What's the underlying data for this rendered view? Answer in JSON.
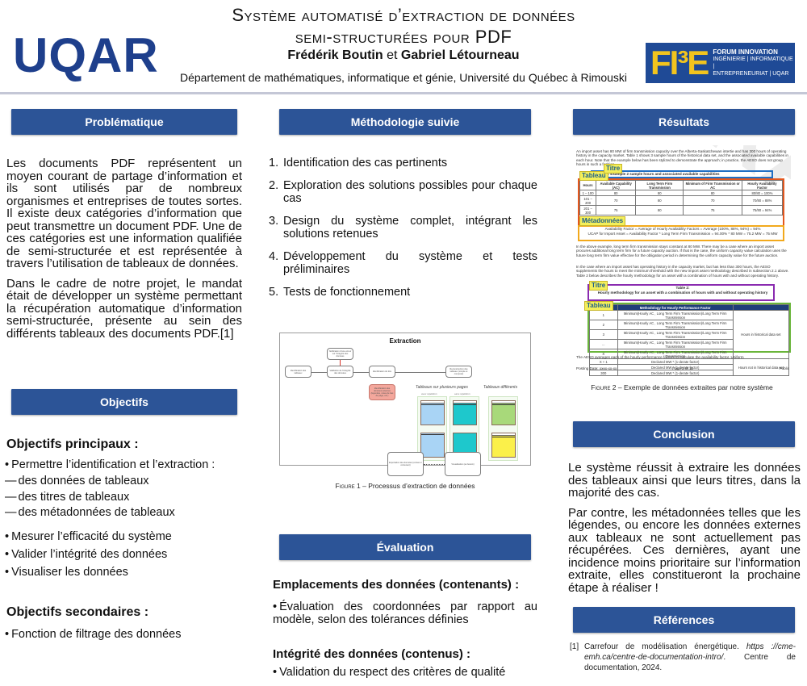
{
  "header": {
    "logo_left": "UQAR",
    "title_line1": "Système automatisé d’extraction de données",
    "title_line2": "semi-structurées pour PDF",
    "author1": "Frédérik Boutin",
    "author_joiner": " et ",
    "author2": "Gabriel Létourneau",
    "department": "Département de mathématiques, informatique et génie, Université du Québec à Rimouski",
    "logo_right": {
      "letters": "FI³E",
      "line1": "FORUM INNOVATION",
      "line2": "INGÉNIERIE | INFORMATIQUE |",
      "line3": "ENTREPRENEURIAT | UQAR"
    }
  },
  "colors": {
    "section_bar": "#2c5497",
    "uqar_blue": "#1e3f8c",
    "fie_blue": "#1f4a96",
    "fie_yellow": "#f2c41e"
  },
  "problematique": {
    "title": "Problématique",
    "paragraphs": [
      "Les documents PDF représentent un moyen courant de partage d’information et ils sont utilisés par de nombreux organismes et entreprises de toutes sortes. Il existe deux catégories d’information que peut transmettre un document PDF. Une de ces catégories est une information qualifiée de semi-structurée et est représentée à travers l’utilisation de tableaux de données.",
      "Dans le cadre de notre projet, le mandat était de développer un système permettant la récupération automatique d’information semi-structurée, présente au sein des différents tableaux des documents PDF.[1]"
    ]
  },
  "objectifs": {
    "title": "Objectifs",
    "principaux_title": "Objectifs principaux :",
    "principaux": [
      "Permettre l’identification et l’extraction :",
      "Mesurer l’efficacité du système",
      "Valider l’intégrité des données",
      "Visualiser les données"
    ],
    "sub_items": [
      "des données de tableaux",
      "des titres de tableaux",
      "des métadonnées de tableaux"
    ],
    "secondaires_title": "Objectifs secondaires :",
    "secondaires": [
      "Fonction de filtrage des données"
    ]
  },
  "methodologie": {
    "title": "Méthodologie suivie",
    "steps": [
      {
        "num": "1.",
        "text": "Identification des cas pertinents"
      },
      {
        "num": "2.",
        "text": "Exploration des solutions possibles pour chaque cas"
      },
      {
        "num": "3.",
        "text": "Design du système complet, intégrant les solutions retenues"
      },
      {
        "num": "4.",
        "text": "Développement du système et tests préliminaires"
      },
      {
        "num": "5.",
        "text": "Tests de fonctionnement"
      }
    ],
    "figure1": {
      "title": "Extraction",
      "nodes": {
        "identification_tableaux": "Identification des tableaux",
        "notification_erreur": "Notification d’une erreur sur l’intégrité des données",
        "validation_integrite": "Validation de l’intégrité des données",
        "identification_titre": "Identification du titre",
        "identification_donnees_externes": "Identification des données externes (légendes, notes de bas de page, etc.)",
        "reconstruction": "Reconstruction des tableaux (simple et composé)",
        "exportation": "Exportation des données (contenu / contenant)",
        "visualisation": "Visualisation (au besoin)"
      },
      "label_multi_pages": "Tableaux sur plusieurs pages",
      "label_avec_repetition": "avec répétition",
      "label_sans_repetition": "sans répétition",
      "label_differents": "Tableaux différents",
      "cell_titre": "Titre",
      "cell_entete": "En-tête",
      "caption_prefix": "Figure 1",
      "caption_text": " – Processus d’extraction de données"
    }
  },
  "evaluation": {
    "title": "Évaluation",
    "contenants_title": "Emplacements des données (contenants) :",
    "contenants_items": [
      "Évaluation des coordonnées par rapport au modèle, selon des tolérances définies"
    ],
    "contenus_title": "Intégrité des données (contenus) :",
    "contenus_items": [
      "Validation du respect des critères de qualité"
    ]
  },
  "resultats": {
    "title": "Résultats",
    "figure2": {
      "intro_text": "An import asset has 80 MW of firm transmission capacity over the Alberta-Saskatchewan intertie and has 300 hours of operating history in the capacity market. Table 1 shows 3 sample hours of the historical data set, and the associated available capabilities in each hour. Note that the example below has been stylized to demonstrate the approach; in practice, the AESO does not group hours in such a fashion.",
      "tag_titre": "Titre",
      "tag_tableau": "Tableau",
      "tag_metadonnees": "Métadonnées",
      "table1_title": "Table 1: Example 2 sample hours and associated available capabilities",
      "table1_headers": [
        "Hours",
        "Available Capability (AC)",
        "Long Term Firm Transmission",
        "Minimum of Firm Transmission or AC",
        "Hourly Availability Factor"
      ],
      "table1_rows": [
        [
          "1 – 100",
          "80",
          "80",
          "80",
          "80/80 = 100%"
        ],
        [
          "101 – 200",
          "70",
          "80",
          "70",
          "70/80 = 88%"
        ],
        [
          "201 – 300",
          "75",
          "80",
          "75",
          "75/80 = 94%"
        ]
      ],
      "meta_line1": "Availability Factor = Average of Hourly Availability Factors = Average (100%, 88%, 94%) = 94%",
      "meta_line2": "UCAP for Import Asset = Availability Factor * Long Term Firm Transmission = 94.00% * 80 MW = 75.2 MW = 75 MW",
      "para2": "In the above example, long term firm transmission stays constant at 80 MW. There may be a case where an import asset procures additional long term firm for a future capacity auction. If that is the case, the uniform capacity value calculation uses the future long term firm value effective for the obligation period in determining the uniform capacity value for the future auction.",
      "para3": "In the case where an import asset has operating history in the capacity market, but has less than 300 hours, the AESO supplements the hours to meet the minimum threshold with the new import asset methodology described in subsection 2.1 above. Table 2 below describes the hourly methodology for an asset with a combination of hours with and without operating history.",
      "table2_title_a": "Table 2:",
      "table2_title_b": "Hourly methodology for an asset with a combination of hours with and without operating history",
      "table2_headers": [
        "Hour",
        "Methodology for Hourly Performance Factor",
        ""
      ],
      "table2_rows": [
        [
          "1",
          "Minimum(Hourly AC , Long Term Firm Transmission)/Long Term Firm Transmission"
        ],
        [
          "2",
          "Minimum(Hourly AC , Long Term Firm Transmission)/Long Term Firm Transmission"
        ],
        [
          "3",
          "Minimum(Hourly AC , Long Term Firm Transmission)/Long Term Firm Transmission"
        ],
        [
          "...",
          "Minimum(Hourly AC , Long Term Firm Transmission)/Long Term Firm Transmission"
        ],
        [
          "X",
          "Minimum(Hourly AC , Long Term Firm Transmission)/Long Term Firm Transmission"
        ],
        [
          "X + 1",
          "Declared MW * (1-derate factor)"
        ],
        [
          "...",
          "Declared MW * (1-derate factor)"
        ],
        [
          "300",
          "Declared MW * (1-derate factor)"
        ]
      ],
      "table2_group1": "Hours in historical data set",
      "table2_group2": "Hours not in historical data set",
      "closing_text": "The AESO averages each of the hourly performance factors to calculate the availability factor. Uniform",
      "footer_left": "Posting Date: xxxx-xx-xx",
      "footer_center": "Page 2 of 11",
      "footer_right": "Public",
      "watermark": "DRAFT",
      "caption_prefix": "Figure 2",
      "caption_text": " – Exemple de données extraites par notre système"
    }
  },
  "conclusion": {
    "title": "Conclusion",
    "paragraphs": [
      "Le système réussit à extraire les données des tableaux ainsi que leurs titres, dans la majorité des cas.",
      "Par contre, les métadonnées telles que les légendes, ou encore les données externes aux tableaux ne sont actuellement pas récupérées. Ces dernières, ayant une incidence moins prioritaire sur l’information extraite, elles constitueront la prochaine étape à réaliser !"
    ]
  },
  "references": {
    "title": "Références",
    "items": [
      {
        "num": "[1]",
        "text_before": "Carrefour de modélisation énergétique. ",
        "url": "https ://cme-emh.ca/centre-de-documentation-intro/",
        "text_after": ". Centre de documentation, 2024."
      }
    ]
  }
}
